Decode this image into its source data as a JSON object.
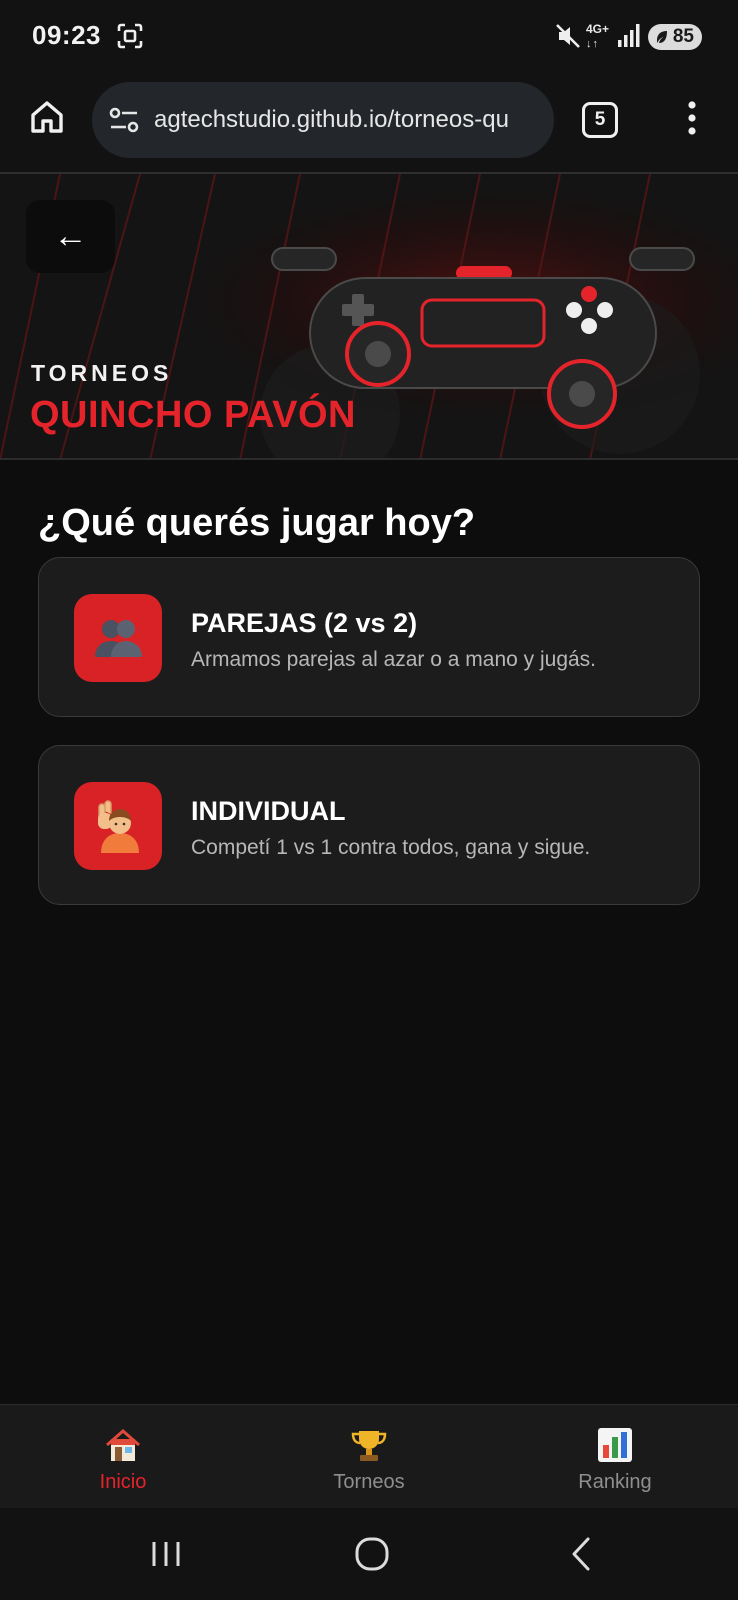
{
  "status_bar": {
    "time": "09:23",
    "network": "4G+",
    "battery": "85",
    "icons": [
      "screenshot-icon",
      "mute-icon",
      "signal-icon",
      "battery-icon"
    ]
  },
  "browser": {
    "url": "agtechstudio.github.io/torneos-qu",
    "tab_count": "5",
    "icons": [
      "home-icon",
      "site-settings-icon",
      "tabs-icon",
      "more-menu-icon"
    ]
  },
  "hero": {
    "back_label": "←",
    "subtitle": "TORNEOS",
    "title": "QUINCHO PAVÓN",
    "accent_color": "#e4242a"
  },
  "main": {
    "question": "¿Qué querés jugar hoy?",
    "modes": [
      {
        "title": "PAREJAS (2 vs 2)",
        "description": "Armamos parejas al azar o a mano y jugás.",
        "icon": "people-icon"
      },
      {
        "title": "INDIVIDUAL",
        "description": "Competí 1 vs 1 contra todos, gana y sigue.",
        "icon": "person-raising-hand-icon"
      }
    ]
  },
  "bottom_nav": {
    "items": [
      {
        "label": "Inicio",
        "icon": "house-icon",
        "active": true
      },
      {
        "label": "Torneos",
        "icon": "trophy-icon",
        "active": false
      },
      {
        "label": "Ranking",
        "icon": "bar-chart-icon",
        "active": false
      }
    ]
  },
  "system_nav": {
    "icons": [
      "recent-apps-icon",
      "home-circle-icon",
      "back-chevron-icon"
    ]
  },
  "colors": {
    "background": "#0d0d0d",
    "card": "#1c1c1c",
    "accent": "#e4242a",
    "muted_text": "#b7b7b7"
  }
}
